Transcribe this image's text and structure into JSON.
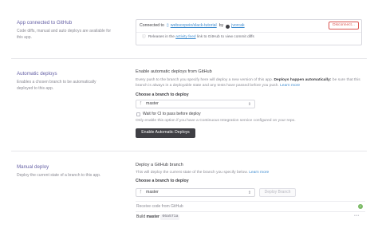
{
  "github": {
    "title": "App connected to GitHub",
    "description": "Code diffs, manual and auto deploys are available for this app.",
    "connected_prefix": "Connected to",
    "repo_link": "webscopeio/slack-tutorial",
    "by": "by",
    "user_link": "jvorcak",
    "disconnect_label": "Disconnect...",
    "releases_prefix": "Releases in the",
    "activity_feed_link": "activity feed",
    "releases_suffix": "link to GitHub to view commit diffs"
  },
  "auto_deploys": {
    "title": "Automatic deploys",
    "description": "Enables a chosen branch to be automatically deployed to this app.",
    "heading": "Enable automatic deploys from GitHub",
    "info_part1": "Every push to the branch you specify here will deploy a new version of this app.",
    "info_bold": "Deploys happen automatically:",
    "info_part2": "be sure that this branch is always in a deployable state and any tests have passed before you push.",
    "learn_more": "Learn more",
    "choose_label": "Choose a branch to deploy",
    "branch_value": "master",
    "wait_ci_label": "Wait for CI to pass before deploy",
    "wait_ci_help": "Only enable this option if you have a Continuous Integration service configured on your repo.",
    "enable_button": "Enable Automatic Deploys"
  },
  "manual_deploy": {
    "title": "Manual deploy",
    "description": "Deploy the current state of a branch to this app.",
    "heading": "Deploy a GitHub branch",
    "info": "This will deploy the current state of the branch you specify below.",
    "learn_more": "Learn more",
    "choose_label": "Choose a branch to deploy",
    "branch_value": "master",
    "deploy_button": "Deploy Branch",
    "step1": "Receive code from GitHub",
    "step2_prefix": "Build",
    "step2_branch": "master",
    "step2_hash": "66a571a"
  },
  "colors": {
    "accent": "#6762a6",
    "link": "#3f8ccf",
    "danger": "#d9534f",
    "success": "#79b963"
  }
}
